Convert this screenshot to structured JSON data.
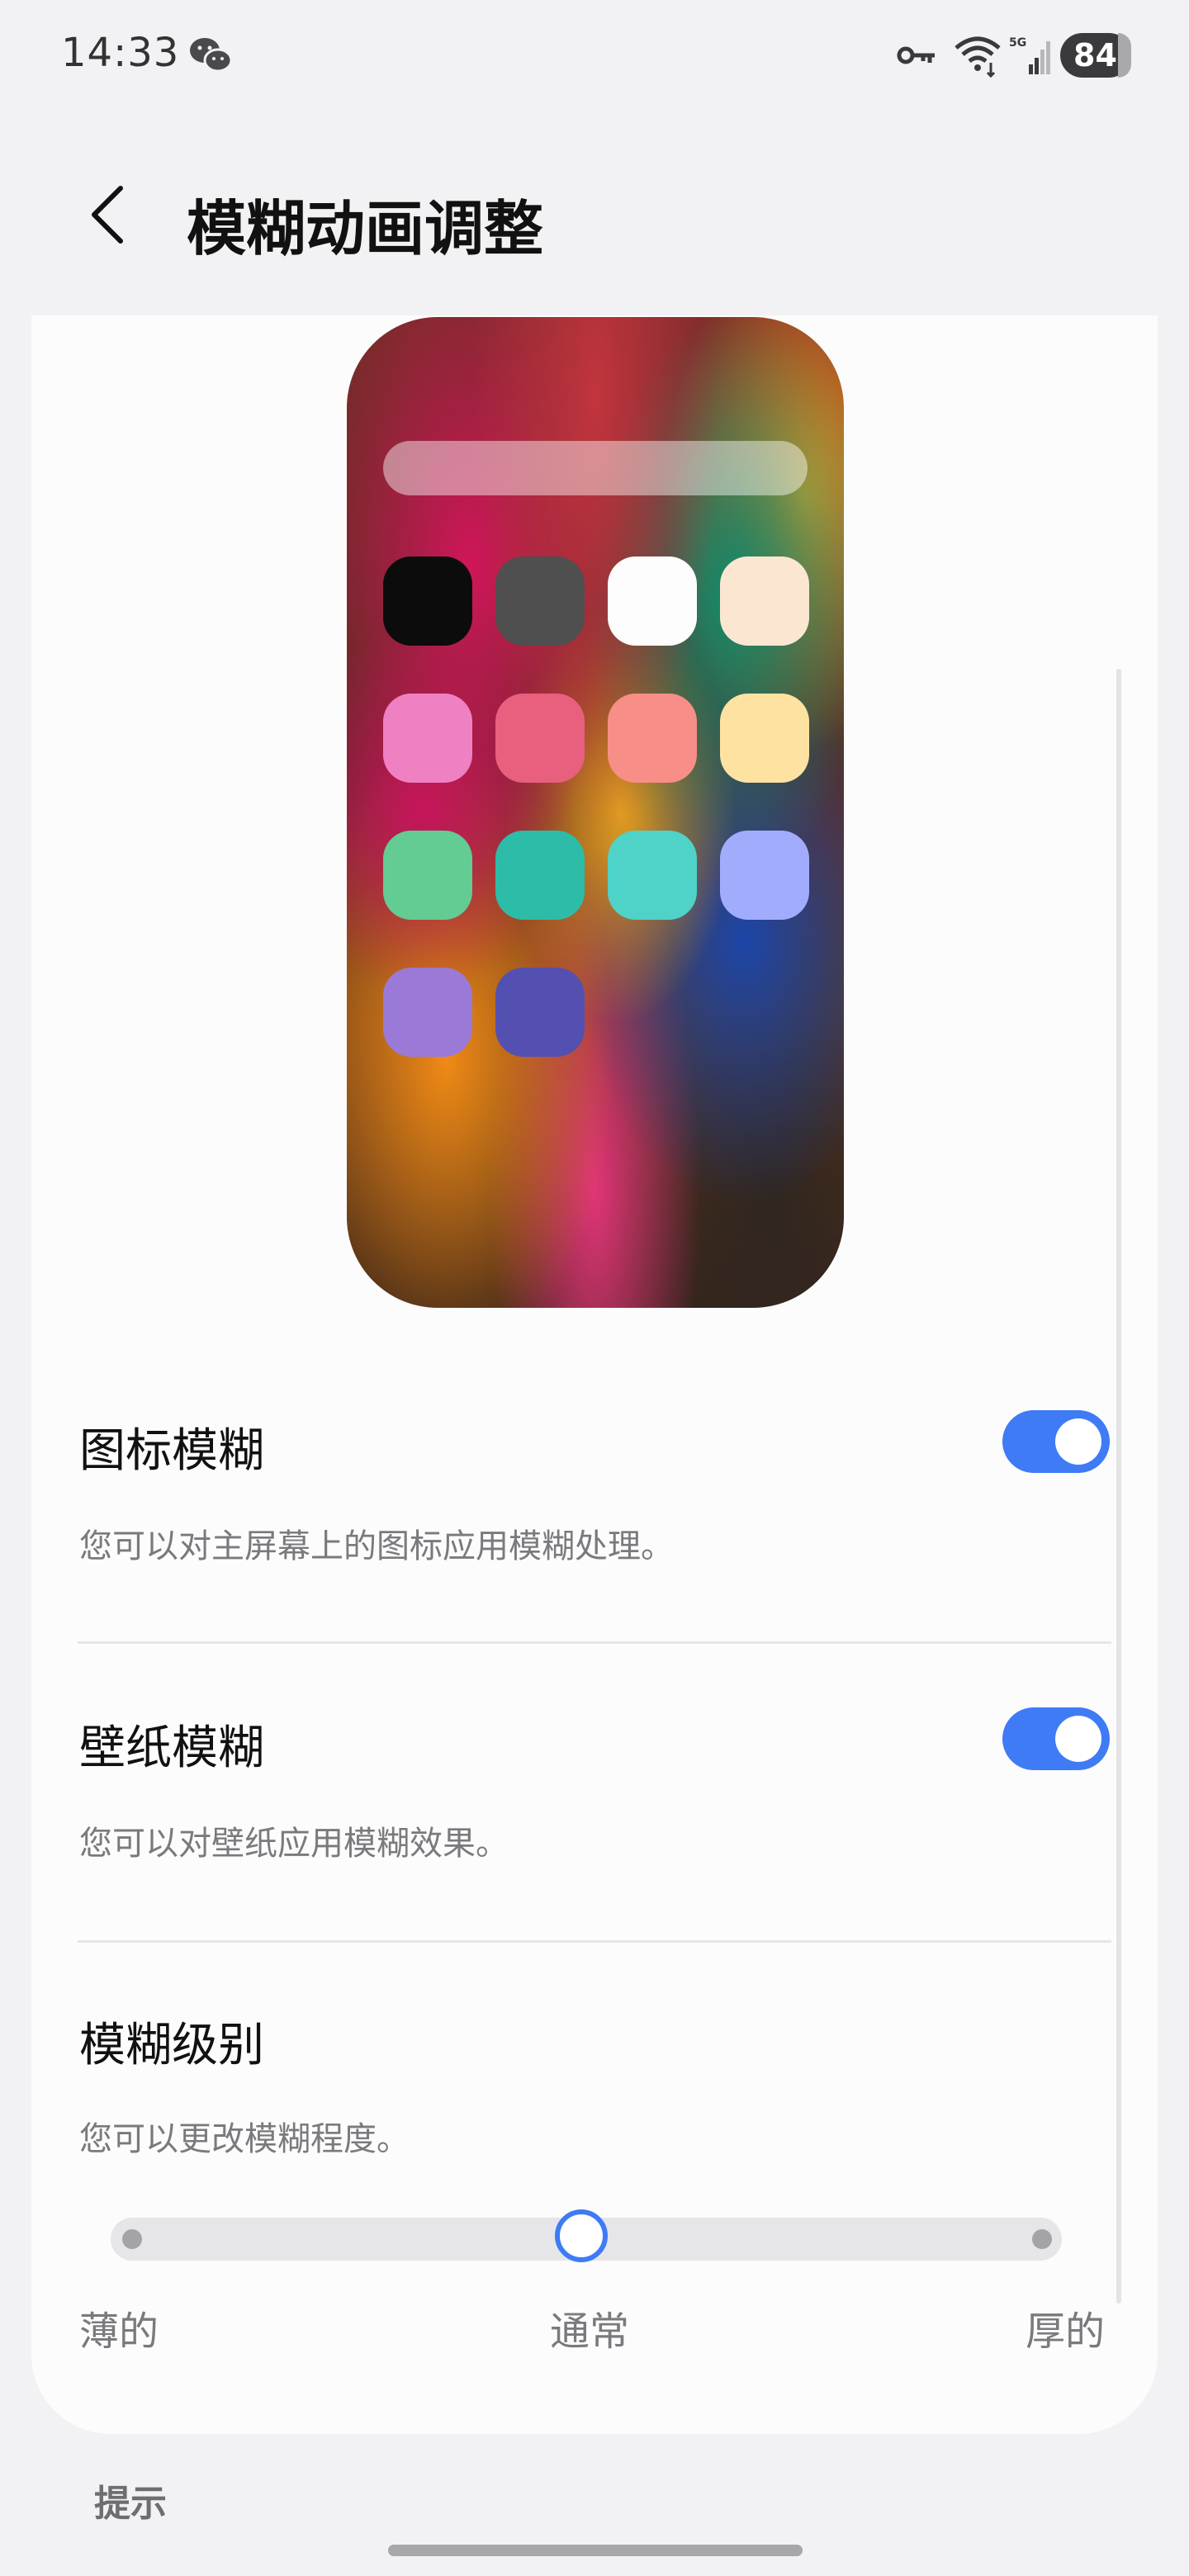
{
  "status_bar": {
    "time": "14:33",
    "battery": "84",
    "network": "5G"
  },
  "header": {
    "title": "模糊动画调整"
  },
  "settings": [
    {
      "title": "图标模糊",
      "description": "您可以对主屏幕上的图标应用模糊处理。",
      "enabled": true
    },
    {
      "title": "壁纸模糊",
      "description": "您可以对壁纸应用模糊效果。",
      "enabled": true
    },
    {
      "title": "模糊级别",
      "description": "您可以更改模糊程度。"
    }
  ],
  "blur_slider": {
    "labels": [
      "薄的",
      "通常",
      "厚的"
    ],
    "selected": "通常",
    "accent_color": "#3e7bf5"
  },
  "footer": {
    "tips": "提示"
  }
}
